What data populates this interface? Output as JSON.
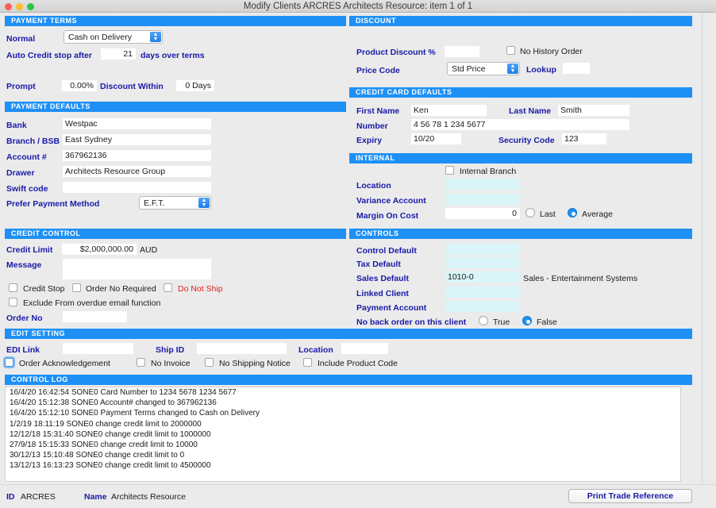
{
  "window": {
    "title": "Modify Clients ARCRES Architects Resource: item 1  of  1",
    "traffic_lights": [
      "close-button",
      "minimize-button",
      "zoom-button"
    ]
  },
  "colors": {
    "section_header_bg": "#1e90f5",
    "label_blue": "#1a1aa8",
    "warning_red": "#e02020",
    "field_cyan": "#d9f5f8",
    "window_bg": "#ebebeb"
  },
  "payment_terms": {
    "header": "PAYMENT TERMS",
    "normal_label": "Normal",
    "normal_value": "Cash on Delivery",
    "auto_credit_label": "Auto Credit stop after",
    "auto_credit_days": "21",
    "days_over_terms_label": "days over terms",
    "prompt_label": "Prompt",
    "prompt_value": "0.00%",
    "discount_within_label": "Discount Within",
    "discount_within_value": "0 Days"
  },
  "payment_defaults": {
    "header": "PAYMENT DEFAULTS",
    "bank_label": "Bank",
    "bank_value": "Westpac",
    "branch_label": "Branch / BSB",
    "branch_value": "East Sydney",
    "account_label": "Account #",
    "account_value": "367962136",
    "drawer_label": "Drawer",
    "drawer_value": "Architects Resource Group",
    "swift_label": "Swift code",
    "swift_value": "",
    "prefer_method_label": "Prefer Payment Method",
    "prefer_method_value": "E.F.T."
  },
  "credit_control": {
    "header": "CREDIT CONTROL",
    "credit_limit_label": "Credit Limit",
    "credit_limit_value": "$2,000,000.00",
    "credit_limit_currency": "AUD",
    "message_label": "Message",
    "message_value": "",
    "credit_stop_label": "Credit Stop",
    "order_no_required_label": "Order No Required",
    "do_not_ship_label": "Do Not Ship",
    "exclude_overdue_label": "Exclude From overdue email function",
    "order_no_label": "Order No",
    "order_no_value": ""
  },
  "edit_setting": {
    "header": "EDIT SETTING",
    "edi_link_label": "EDI Link",
    "edi_link_value": "",
    "ship_id_label": "Ship ID",
    "ship_id_value": "",
    "location_label": "Location",
    "location_value": "",
    "order_ack_label": "Order Acknowledgement",
    "no_invoice_label": "No Invoice",
    "no_shipping_notice_label": "No Shipping Notice",
    "include_product_code_label": "Include Product Code"
  },
  "discount": {
    "header": "DISCOUNT",
    "product_discount_label": "Product Discount %",
    "product_discount_value": "",
    "no_history_order_label": "No History Order",
    "price_code_label": "Price Code",
    "price_code_value": "Std Price",
    "lookup_label": "Lookup",
    "lookup_value": ""
  },
  "credit_card_defaults": {
    "header": "CREDIT CARD DEFAULTS",
    "first_name_label": "First Name",
    "first_name_value": "Ken",
    "last_name_label": "Last Name",
    "last_name_value": "Smith",
    "number_label": "Number",
    "number_value": "4 56 78 1 234  5677",
    "expiry_label": "Expiry",
    "expiry_value": "10/20",
    "security_code_label": "Security Code",
    "security_code_value": "123"
  },
  "internal": {
    "header": "INTERNAL",
    "internal_branch_label": "Internal Branch",
    "location_label": "Location",
    "location_value": "",
    "variance_account_label": "Variance Account",
    "variance_account_value": "",
    "margin_on_cost_label": "Margin On Cost",
    "margin_on_cost_value": "0",
    "last_label": "Last",
    "average_label": "Average",
    "margin_selected": "Average"
  },
  "controls": {
    "header": "CONTROLS",
    "control_default_label": "Control Default",
    "control_default_value": "",
    "tax_default_label": "Tax Default",
    "tax_default_value": "",
    "sales_default_label": "Sales Default",
    "sales_default_value": "1010-0",
    "sales_default_desc": "Sales - Entertainment Systems",
    "linked_client_label": "Linked Client",
    "linked_client_value": "",
    "payment_account_label": "Payment Account",
    "payment_account_value": "",
    "no_back_order_label": "No back order on this client",
    "true_label": "True",
    "false_label": "False",
    "no_back_order_selected": "False"
  },
  "control_log": {
    "header": "CONTROL LOG",
    "entries": [
      "16/4/20 16:42:54 SONE0 Card Number to 1234 5678 1234 5677",
      "16/4/20 15:12:38 SONE0 Account#  changed to 367962136",
      "16/4/20 15:12:10 SONE0 Payment Terms changed to Cash on Delivery",
      "1/2/19 18:11:19 SONE0 change credit limit to 2000000",
      "12/12/18 15:31:40 SONE0 change credit limit to 1000000",
      "27/9/18 15:15:33 SONE0 change credit limit to 10000",
      "30/12/13 15:10:48 SONE0 change credit limit to 0",
      "13/12/13 16:13:23 SONE0 change credit limit to 4500000"
    ]
  },
  "footer": {
    "id_label": "ID",
    "id_value": "ARCRES",
    "name_label": "Name",
    "name_value": "Architects Resource",
    "print_button_label": "Print Trade Reference"
  }
}
